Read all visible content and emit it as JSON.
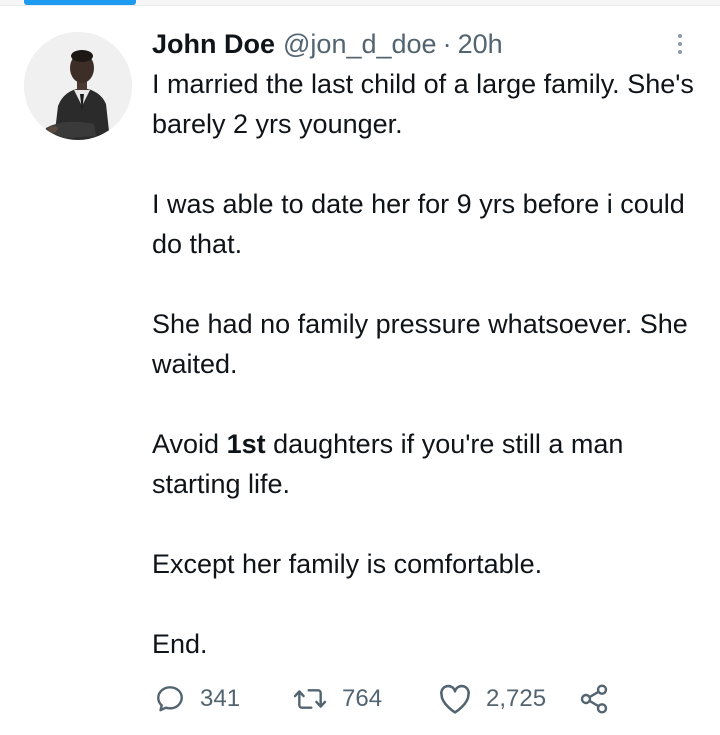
{
  "colors": {
    "accent": "#1d9bf0",
    "text": "#0f1419",
    "muted": "#536471"
  },
  "tweet": {
    "author": {
      "name": "John Doe",
      "handle": "@jon_d_doe",
      "separator": "·",
      "time": "20h"
    },
    "paragraphs": [
      {
        "text": "I married the last child of a large family. She's barely 2 yrs younger."
      },
      {
        "text": "I was able to date her for 9 yrs before i could do that."
      },
      {
        "text": "She had no family pressure whatsoever. She waited."
      },
      {
        "before": "Avoid ",
        "bold": "1st",
        "after": " daughters if you're still a man starting life."
      },
      {
        "text": "Except her family is comfortable."
      },
      {
        "text": "End."
      }
    ],
    "actions": {
      "reply": {
        "icon": "reply-icon",
        "count": "341"
      },
      "retweet": {
        "icon": "retweet-icon",
        "count": "764"
      },
      "like": {
        "icon": "heart-icon",
        "count": "2,725"
      },
      "share": {
        "icon": "share-icon"
      }
    }
  }
}
